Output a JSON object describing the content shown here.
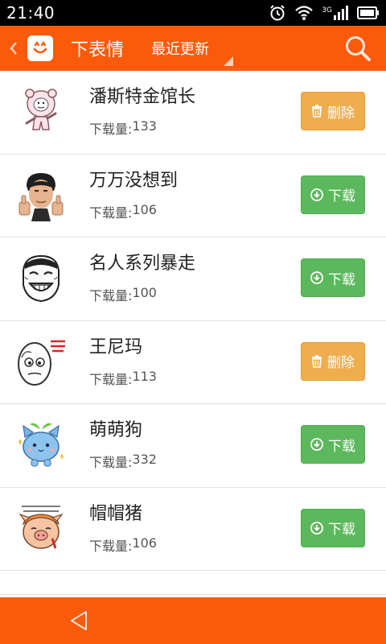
{
  "status_bar": {
    "time": "21:40",
    "network_type": "3G"
  },
  "app_bar": {
    "title": "下表情",
    "sort_label": "最近更新",
    "colors": {
      "primary": "#fc5a0b"
    }
  },
  "list": {
    "download_count_label": "下载量: ",
    "items": [
      {
        "name": "潘斯特金馆长",
        "download_count": "133",
        "action_label": "删除",
        "action_type": "delete",
        "thumb": "baozou-pink-bear-meme-icon"
      },
      {
        "name": "万万没想到",
        "download_count": "106",
        "action_label": "下载",
        "action_type": "download",
        "thumb": "thumbs-up-man-meme-icon"
      },
      {
        "name": "名人系列暴走",
        "download_count": "100",
        "action_label": "下载",
        "action_type": "download",
        "thumb": "laughing-man-rage-face-icon"
      },
      {
        "name": "王尼玛",
        "download_count": "113",
        "action_label": "删除",
        "action_type": "delete",
        "thumb": "wang-nima-face-icon"
      },
      {
        "name": "萌萌狗",
        "download_count": "332",
        "action_label": "下载",
        "action_type": "download",
        "thumb": "cute-blue-dog-icon"
      },
      {
        "name": "帽帽猪",
        "download_count": "106",
        "action_label": "下载",
        "action_type": "download",
        "thumb": "hat-pig-icon"
      }
    ],
    "action_colors": {
      "delete": "#f0ad4e",
      "download": "#5cb85c"
    }
  },
  "nav_bar": {
    "back_icon": "triangle-back-icon"
  }
}
